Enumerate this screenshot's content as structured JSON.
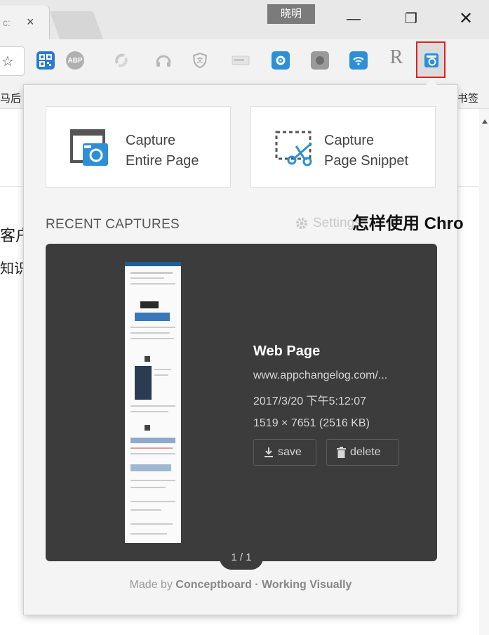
{
  "browser": {
    "tab_label": "c:",
    "tab_close": "×",
    "profile_name": "晓明",
    "window_controls": {
      "minimize": "—",
      "restore": "❐",
      "close": "✕"
    }
  },
  "toolbar": {
    "star_icon": "☆",
    "extensions": [
      "qr-code-extension",
      "adblock-plus-extension",
      "sync-extension",
      "headphones-extension",
      "shield-extension",
      "card-extension",
      "blue-gear-extension",
      "gray-extension",
      "wifi-extension",
      "r-extension",
      "full-page-screen-capture-extension"
    ],
    "r_label": "R",
    "adp_label": "ABP",
    "menu_icon": "⋮"
  },
  "bookmarks": {
    "left_text": "马后",
    "right_text": "书签"
  },
  "page_behind": {
    "text1": "客户",
    "text2": "知识",
    "heading": "怎样使用 Chro"
  },
  "popup": {
    "capture_entire": {
      "line1": "Capture",
      "line2": "Entire Page"
    },
    "capture_snippet": {
      "line1": "Capture",
      "line2": "Page Snippet"
    },
    "recent_title": "RECENT CAPTURES",
    "settings_label": "Settings",
    "capture": {
      "title": "Web Page",
      "url": "www.appchangelog.com/...",
      "datetime": "2017/3/20 下午5:12:07",
      "dimensions": "1519 × 7651 (2516 KB)",
      "save_label": "save",
      "delete_label": "delete"
    },
    "pager": "1 / 1",
    "footer": {
      "made_by": "Made by",
      "brand": "Conceptboard · Working Visually"
    }
  },
  "colors": {
    "accent_blue": "#2d8fd6",
    "highlight_red": "#e0201c",
    "viewer_bg": "#3c3c3c"
  }
}
